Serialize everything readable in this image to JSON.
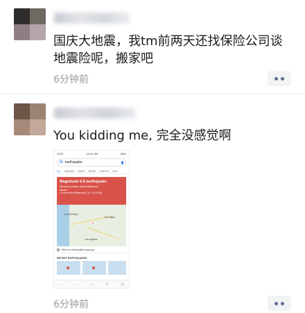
{
  "posts": [
    {
      "content": "国庆大地震，我tm前两天还找保险公司谈地震险呢，搬家吧",
      "time": "6分钟前",
      "avatar_colors": [
        "#2f2d2b",
        "#6e6a62",
        "#8f7e86",
        "#b5a5ad"
      ]
    },
    {
      "content": "You kidding me, 完全没感觉啊",
      "time": "6分钟前",
      "avatar_colors": [
        "#6d5547",
        "#9b8473",
        "#a68978",
        "#c2a898"
      ],
      "screenshot": {
        "status_left": "AT&T",
        "status_time": "10:41 AM",
        "status_right": "58%",
        "search_query": "earthquake",
        "tabs": [
          "ALL",
          "IMAGES",
          "MAPS",
          "NEWS",
          "VIDEOS",
          "SHO"
        ],
        "alert_title": "Magnitude 6.6 earthquake",
        "alert_line1": "Affected countries: United States and",
        "alert_line2": "Mexico",
        "alert_line3": "11 miles from Ridgecrest, CA · 10:33 AM",
        "map_labels": [
          "CALIFORNIA",
          "Las Vegas",
          "Los Angeles"
        ],
        "link_text": "More on earthquake.usgs.gov",
        "recent_header": "RECENT EARTHQUAKES",
        "nav_icons": [
          "back-icon",
          "forward-icon",
          "home-icon",
          "share-icon",
          "tabs-icon"
        ]
      }
    }
  ],
  "icons": {
    "more": "more-dots-icon"
  },
  "colors": {
    "time_text": "#9a9a9a",
    "more_dot": "#5b6b8c",
    "alert_red": "#d9534a"
  }
}
